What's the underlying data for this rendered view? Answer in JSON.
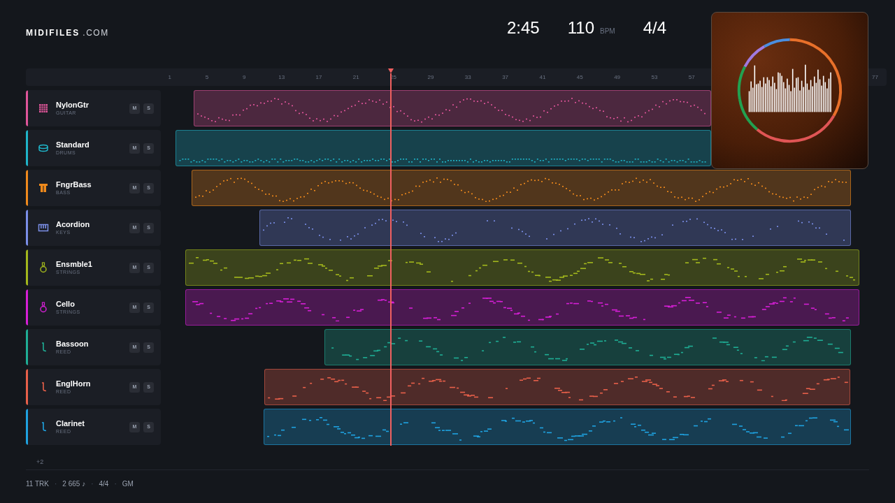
{
  "logo": {
    "brand": "MIDIFILES",
    "suffix": ".COM"
  },
  "stats": [
    {
      "value": "2:45"
    },
    {
      "value": "110",
      "unit": "BPM"
    },
    {
      "value": "4/4"
    }
  ],
  "ruler": {
    "ticks": [
      "1",
      "5",
      "9",
      "13",
      "17",
      "21",
      "25",
      "29",
      "33",
      "37",
      "41",
      "45",
      "49",
      "53",
      "57"
    ],
    "end_tick": "77"
  },
  "tracks": [
    {
      "name": "NylonGtr",
      "category": "GUITAR",
      "kind": "guitar",
      "color": "#e0559a",
      "buttons": [
        "M",
        "S"
      ]
    },
    {
      "name": "Standard",
      "category": "DRUMS",
      "kind": "drums",
      "color": "#1fb5c9",
      "buttons": [
        "M",
        "S"
      ]
    },
    {
      "name": "FngrBass",
      "category": "BASS",
      "kind": "bass",
      "color": "#f08a1c",
      "buttons": [
        "M",
        "S"
      ]
    },
    {
      "name": "Acordion",
      "category": "KEYS",
      "kind": "keys",
      "color": "#7b8fe8",
      "buttons": [
        "M",
        "S"
      ]
    },
    {
      "name": "Ensmble1",
      "category": "STRINGS",
      "kind": "strings",
      "color": "#a3b81c",
      "buttons": [
        "M",
        "S"
      ]
    },
    {
      "name": "Cello",
      "category": "STRINGS",
      "kind": "strings",
      "color": "#d61fd6",
      "buttons": [
        "M",
        "S"
      ]
    },
    {
      "name": "Bassoon",
      "category": "REED",
      "kind": "reed",
      "color": "#1fae95",
      "buttons": [
        "M",
        "S"
      ]
    },
    {
      "name": "EnglHorn",
      "category": "REED",
      "kind": "reed",
      "color": "#e8604a",
      "buttons": [
        "M",
        "S"
      ]
    },
    {
      "name": "Clarinet",
      "category": "REED",
      "kind": "reed",
      "color": "#1fa2e0",
      "buttons": [
        "M",
        "S"
      ]
    }
  ],
  "more_tracks": "+2",
  "footer": {
    "items": [
      "11 TRK",
      "2 665 ♪",
      "4/4",
      "GM"
    ],
    "separator": "·"
  }
}
